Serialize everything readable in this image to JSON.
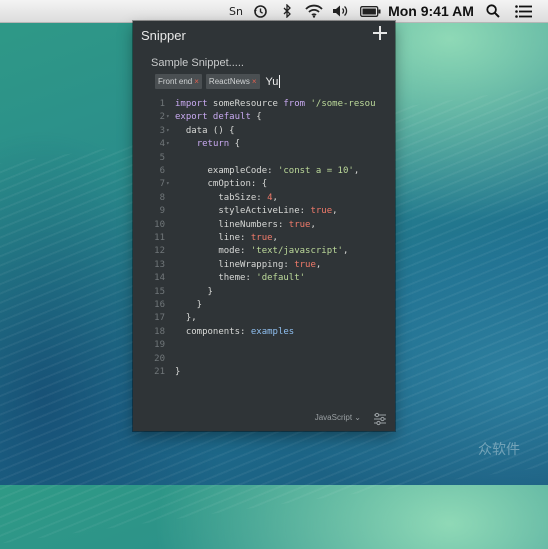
{
  "menubar": {
    "items": [
      {
        "name": "sn-menu-extra",
        "label": "Sn"
      },
      {
        "name": "time-machine-icon"
      },
      {
        "name": "bluetooth-icon"
      },
      {
        "name": "wifi-icon"
      },
      {
        "name": "volume-icon"
      },
      {
        "name": "battery-icon"
      },
      {
        "name": "clock",
        "label": "Mon 9:41 AM"
      },
      {
        "name": "spotlight-search-icon"
      },
      {
        "name": "notification-center-icon"
      }
    ]
  },
  "app": {
    "title": "Snipper",
    "snippet_title": "Sample Snippet.....",
    "tags": [
      {
        "label": "Front end",
        "remove": "×"
      },
      {
        "label": "ReactNews",
        "remove": "×"
      }
    ],
    "tag_input_value": "Yu",
    "footer": {
      "language": "JavaScript ⌄"
    }
  },
  "code": {
    "lines": [
      {
        "n": "1",
        "fold": "",
        "tokens": [
          {
            "t": "kw",
            "v": "import"
          },
          {
            "t": "prop",
            "v": " someResource "
          },
          {
            "t": "kw",
            "v": "from"
          },
          {
            "t": "str",
            "v": " '/some-resou"
          }
        ]
      },
      {
        "n": "2",
        "fold": "▾",
        "tokens": [
          {
            "t": "kw",
            "v": "export default"
          },
          {
            "t": "prop",
            "v": " {"
          }
        ]
      },
      {
        "n": "3",
        "fold": "▾",
        "tokens": [
          {
            "t": "prop",
            "v": "  data () {"
          }
        ]
      },
      {
        "n": "4",
        "fold": "▾",
        "tokens": [
          {
            "t": "prop",
            "v": "    "
          },
          {
            "t": "kw",
            "v": "return"
          },
          {
            "t": "prop",
            "v": " {"
          }
        ]
      },
      {
        "n": "5",
        "fold": "",
        "tokens": []
      },
      {
        "n": "6",
        "fold": "",
        "tokens": [
          {
            "t": "prop",
            "v": "      exampleCode: "
          },
          {
            "t": "str",
            "v": "'const a = 10'"
          },
          {
            "t": "prop",
            "v": ","
          }
        ]
      },
      {
        "n": "7",
        "fold": "▾",
        "tokens": [
          {
            "t": "prop",
            "v": "      cmOption: {"
          }
        ]
      },
      {
        "n": "8",
        "fold": "",
        "tokens": [
          {
            "t": "prop",
            "v": "        tabSize: "
          },
          {
            "t": "num",
            "v": "4"
          },
          {
            "t": "prop",
            "v": ","
          }
        ]
      },
      {
        "n": "9",
        "fold": "",
        "tokens": [
          {
            "t": "prop",
            "v": "        styleActiveLine: "
          },
          {
            "t": "bool",
            "v": "true"
          },
          {
            "t": "prop",
            "v": ","
          }
        ]
      },
      {
        "n": "10",
        "fold": "",
        "tokens": [
          {
            "t": "prop",
            "v": "        lineNumbers: "
          },
          {
            "t": "bool",
            "v": "true"
          },
          {
            "t": "prop",
            "v": ","
          }
        ]
      },
      {
        "n": "11",
        "fold": "",
        "tokens": [
          {
            "t": "prop",
            "v": "        line: "
          },
          {
            "t": "bool",
            "v": "true"
          },
          {
            "t": "prop",
            "v": ","
          }
        ]
      },
      {
        "n": "12",
        "fold": "",
        "tokens": [
          {
            "t": "prop",
            "v": "        mode: "
          },
          {
            "t": "str",
            "v": "'text/javascript'"
          },
          {
            "t": "prop",
            "v": ","
          }
        ]
      },
      {
        "n": "13",
        "fold": "",
        "tokens": [
          {
            "t": "prop",
            "v": "        lineWrapping: "
          },
          {
            "t": "bool",
            "v": "true"
          },
          {
            "t": "prop",
            "v": ","
          }
        ]
      },
      {
        "n": "14",
        "fold": "",
        "tokens": [
          {
            "t": "prop",
            "v": "        theme: "
          },
          {
            "t": "str",
            "v": "'default'"
          }
        ]
      },
      {
        "n": "15",
        "fold": "",
        "tokens": [
          {
            "t": "prop",
            "v": "      }"
          }
        ]
      },
      {
        "n": "16",
        "fold": "",
        "tokens": [
          {
            "t": "prop",
            "v": "    }"
          }
        ]
      },
      {
        "n": "17",
        "fold": "",
        "tokens": [
          {
            "t": "prop",
            "v": "  },"
          }
        ]
      },
      {
        "n": "18",
        "fold": "",
        "tokens": [
          {
            "t": "prop",
            "v": "  components: "
          },
          {
            "t": "var",
            "v": "examples"
          }
        ]
      },
      {
        "n": "19",
        "fold": "",
        "tokens": []
      },
      {
        "n": "20",
        "fold": "",
        "tokens": []
      },
      {
        "n": "21",
        "fold": "",
        "tokens": [
          {
            "t": "prop",
            "v": "}"
          }
        ]
      }
    ]
  },
  "watermark": "众软件",
  "colors": {
    "panel_bg": "#2f3437",
    "keyword": "#c8a9f0",
    "string": "#bcd99a",
    "number": "#f07a6a",
    "variable": "#8fbff0"
  }
}
